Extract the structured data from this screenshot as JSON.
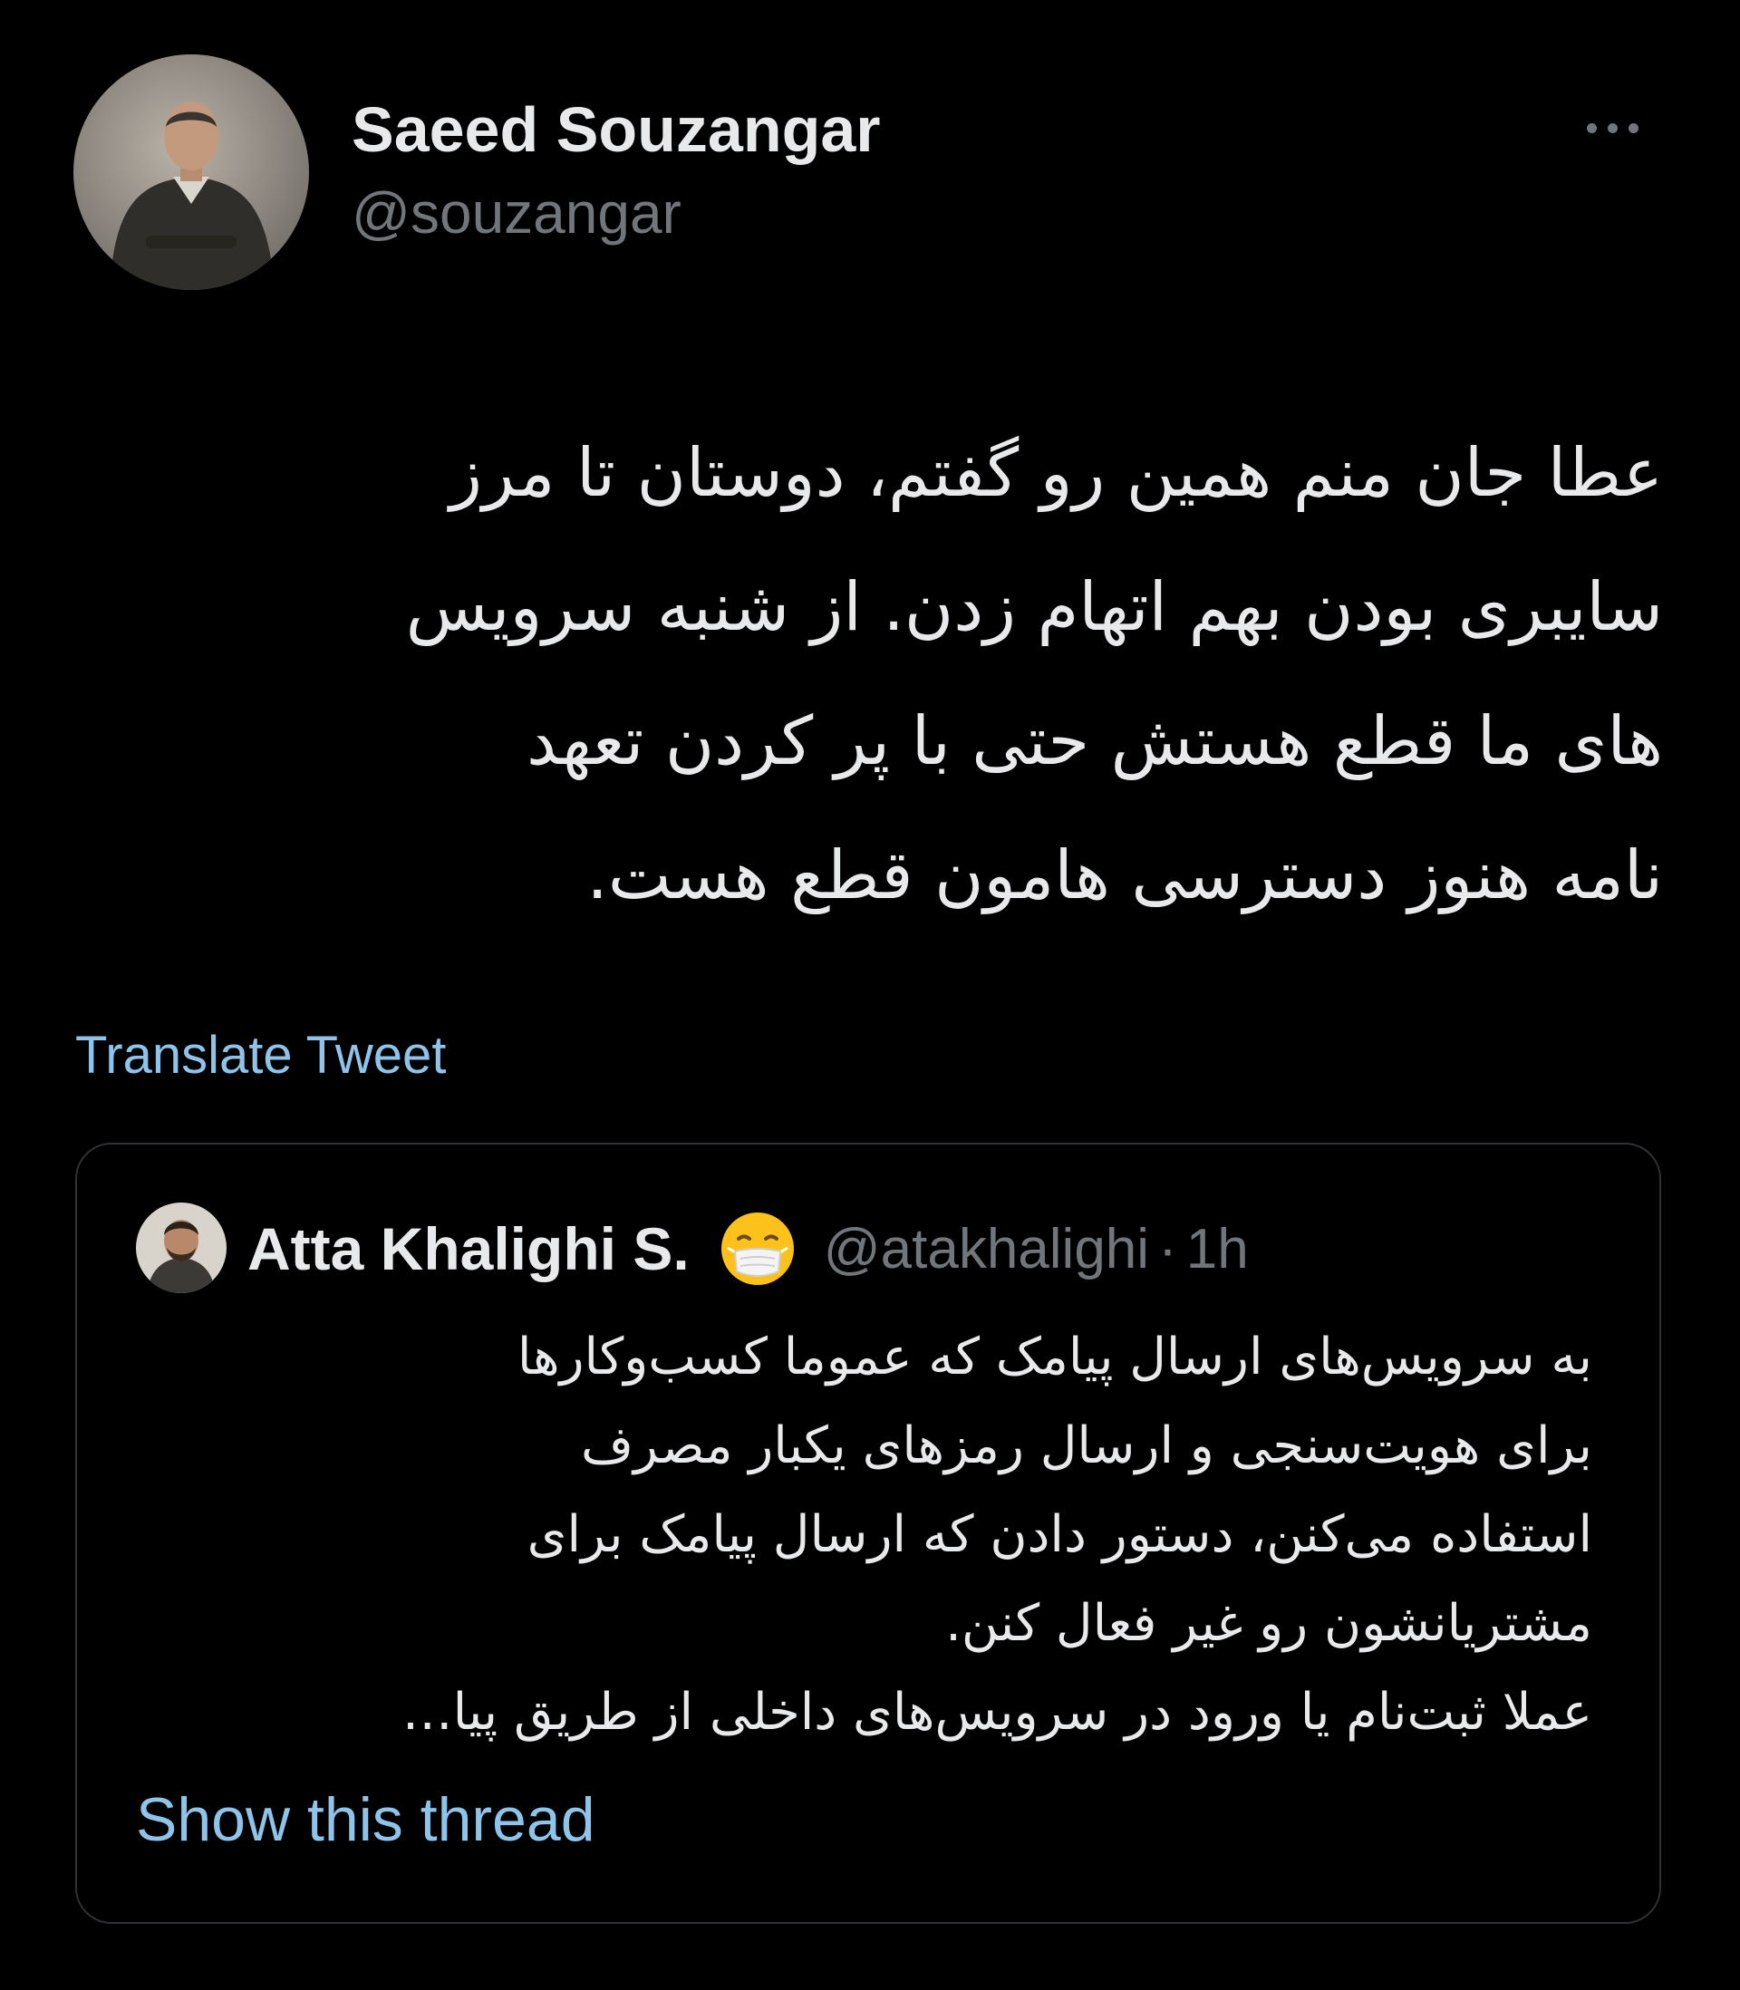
{
  "tweet": {
    "author_name": "Saeed Souzangar",
    "author_handle": "@souzangar",
    "more_label": "More",
    "text_lines": [
      "عطا جان منم همین رو گفتم، دوستان تا مرز",
      "سایبری بودن بهم اتهام زدن. از شنبه سرویس",
      "های ما قطع هستش حتی با پر کردن تعهد",
      "نامه هنوز دسترسی هامون قطع هست."
    ],
    "translate_label": "Translate Tweet"
  },
  "quoted_tweet": {
    "author_name": "Atta Khalighi S.",
    "author_emoji": "face-with-medical-mask",
    "author_handle": "@atakhalighi",
    "separator": "·",
    "time": "1h",
    "text_lines": [
      "به سرویس‌های ارسال پیامک که عموما کسب‌وکارها",
      "برای هویت‌سنجی و ارسال رمزهای یکبار مصرف",
      "استفاده می‌کنن، دستور دادن که ارسال پیامک برای",
      "مشتریانشون رو غیر فعال کنن.",
      "عملا ثبت‌نام یا ورود در سرویس‌های داخلی از طریق پیا…"
    ],
    "show_thread_label": "Show this thread"
  },
  "theme": {
    "background": "#000000",
    "text_primary": "#e7e9ea",
    "text_secondary": "#71767b",
    "link": "#8ec3ea",
    "border": "#2f3336"
  }
}
